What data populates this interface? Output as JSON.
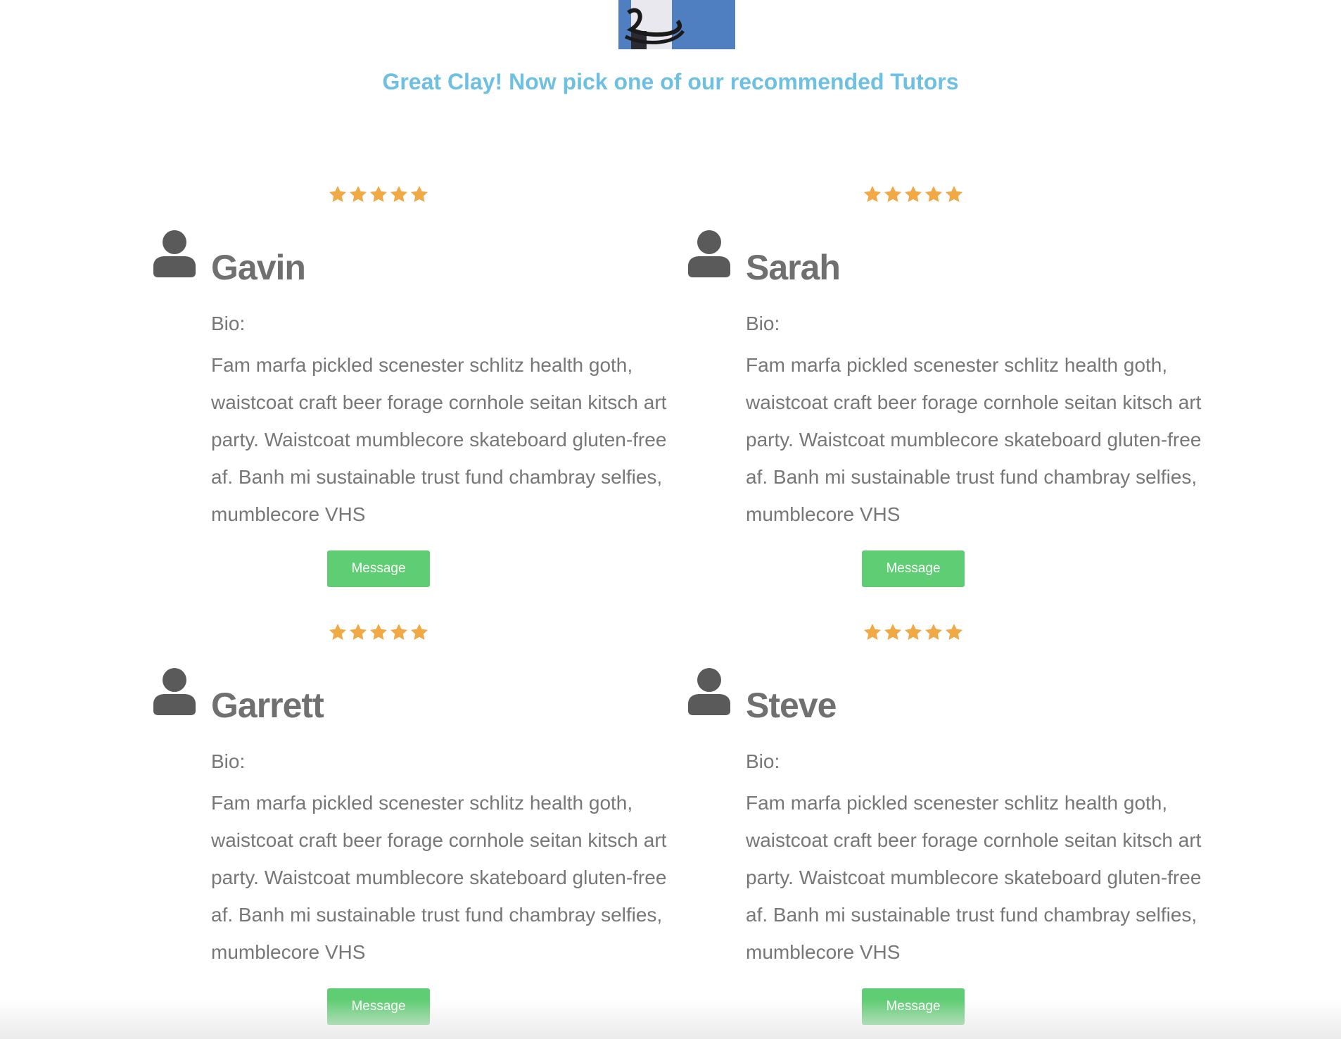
{
  "headline": "Great Clay! Now pick one of our recommended Tutors",
  "colors": {
    "headline": "#6ec0e3",
    "star": "#f0a945",
    "button": "#5fcd73",
    "avatar": "#5a5a5a"
  },
  "tutors": [
    {
      "name": "Gavin",
      "rating": 5,
      "rating_max": 5,
      "bio_label": "Bio:",
      "bio": "Fam marfa pickled scenester schlitz health goth, waistcoat craft beer forage cornhole seitan kitsch art party. Waistcoat mumblecore skateboard gluten-free af. Banh mi sustainable trust fund chambray selfies, mumblecore VHS",
      "button_label": "Message",
      "avatar_icon": "user-icon",
      "star_icon": "star-icon"
    },
    {
      "name": "Sarah",
      "rating": 5,
      "rating_max": 5,
      "bio_label": "Bio:",
      "bio": "Fam marfa pickled scenester schlitz health goth, waistcoat craft beer forage cornhole seitan kitsch art party. Waistcoat mumblecore skateboard gluten-free af. Banh mi sustainable trust fund chambray selfies, mumblecore VHS",
      "button_label": "Message",
      "avatar_icon": "user-icon",
      "star_icon": "star-icon"
    },
    {
      "name": "Garrett",
      "rating": 5,
      "rating_max": 5,
      "bio_label": "Bio:",
      "bio": "Fam marfa pickled scenester schlitz health goth, waistcoat craft beer forage cornhole seitan kitsch art party. Waistcoat mumblecore skateboard gluten-free af. Banh mi sustainable trust fund chambray selfies, mumblecore VHS",
      "button_label": "Message",
      "avatar_icon": "user-icon",
      "star_icon": "star-icon"
    },
    {
      "name": "Steve",
      "rating": 5,
      "rating_max": 5,
      "bio_label": "Bio:",
      "bio": "Fam marfa pickled scenester schlitz health goth, waistcoat craft beer forage cornhole seitan kitsch art party. Waistcoat mumblecore skateboard gluten-free af. Banh mi sustainable trust fund chambray selfies, mumblecore VHS",
      "button_label": "Message",
      "avatar_icon": "user-icon",
      "star_icon": "star-icon"
    }
  ]
}
